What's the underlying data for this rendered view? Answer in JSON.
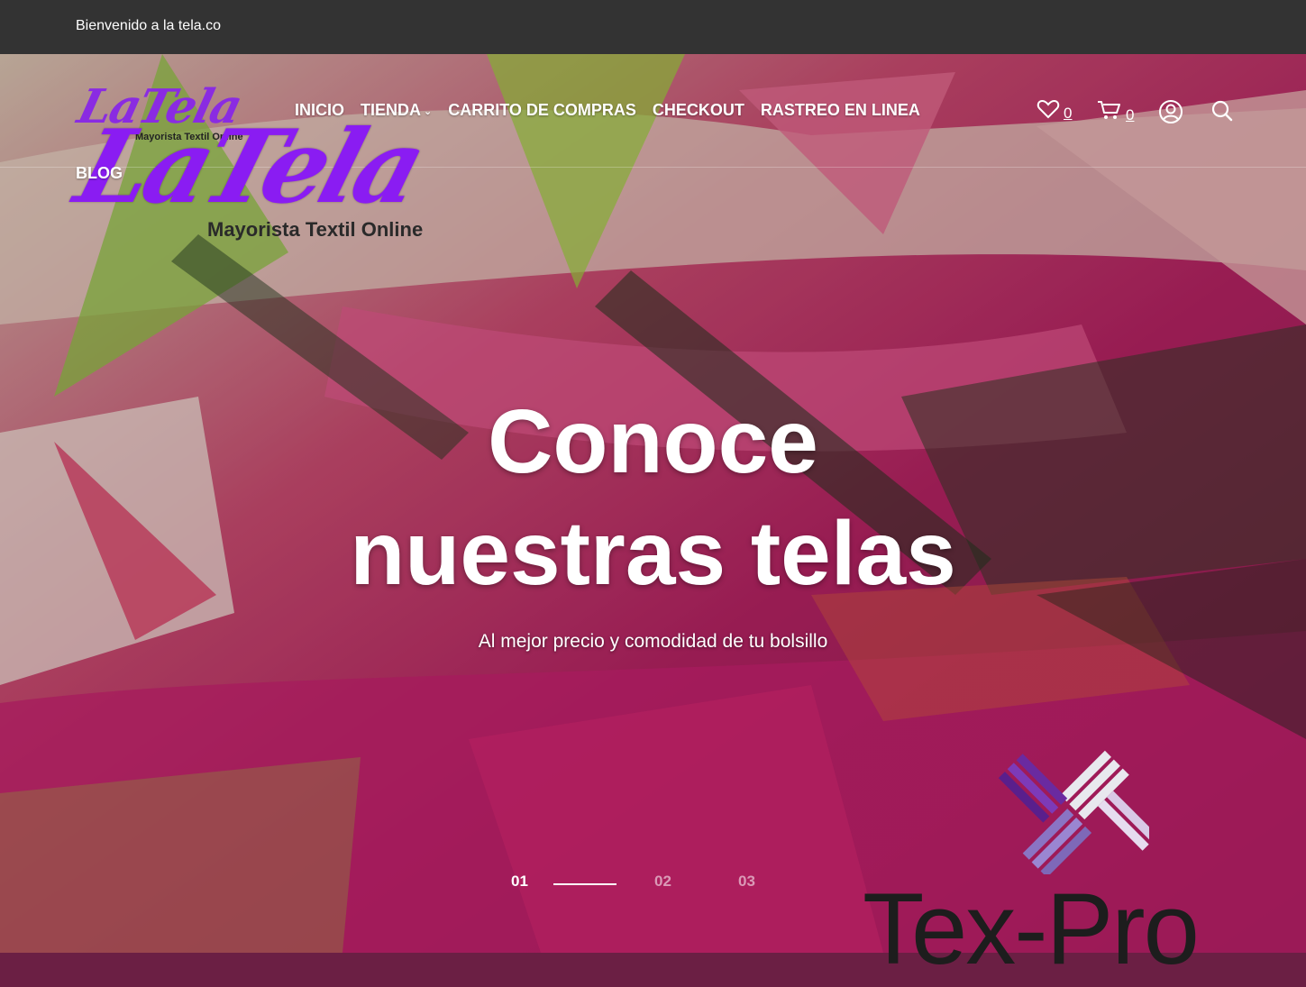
{
  "topbar": {
    "welcome": "Bienvenido a la tela.co"
  },
  "brand": {
    "logo_text": "LaTela",
    "tagline": "Mayorista Textil Online",
    "color": "#8a1cf2"
  },
  "nav": {
    "items": [
      {
        "label": "INICIO"
      },
      {
        "label": "TIENDA",
        "has_dropdown": true,
        "icon": "chevron-down-icon"
      },
      {
        "label": "CARRITO DE COMPRAS"
      },
      {
        "label": "CHECKOUT"
      },
      {
        "label": "RASTREO EN LINEA"
      }
    ],
    "blog": "BLOG"
  },
  "actions": {
    "wishlist": {
      "icon": "heart-icon",
      "count": "0"
    },
    "cart": {
      "icon": "cart-icon",
      "count": "0"
    },
    "account": {
      "icon": "user-icon"
    },
    "search": {
      "icon": "search-icon"
    }
  },
  "hero": {
    "title_line1": "Conoce",
    "title_line2": "nuestras telas",
    "subtitle": "Al mejor precio y comodidad de tu bolsillo"
  },
  "slider": {
    "pages": [
      "01",
      "02",
      "03"
    ],
    "active_index": 0
  },
  "watermark": {
    "text": "Tex-Pro"
  },
  "colors": {
    "topbar_bg": "#333333",
    "text_light": "#ffffff"
  }
}
